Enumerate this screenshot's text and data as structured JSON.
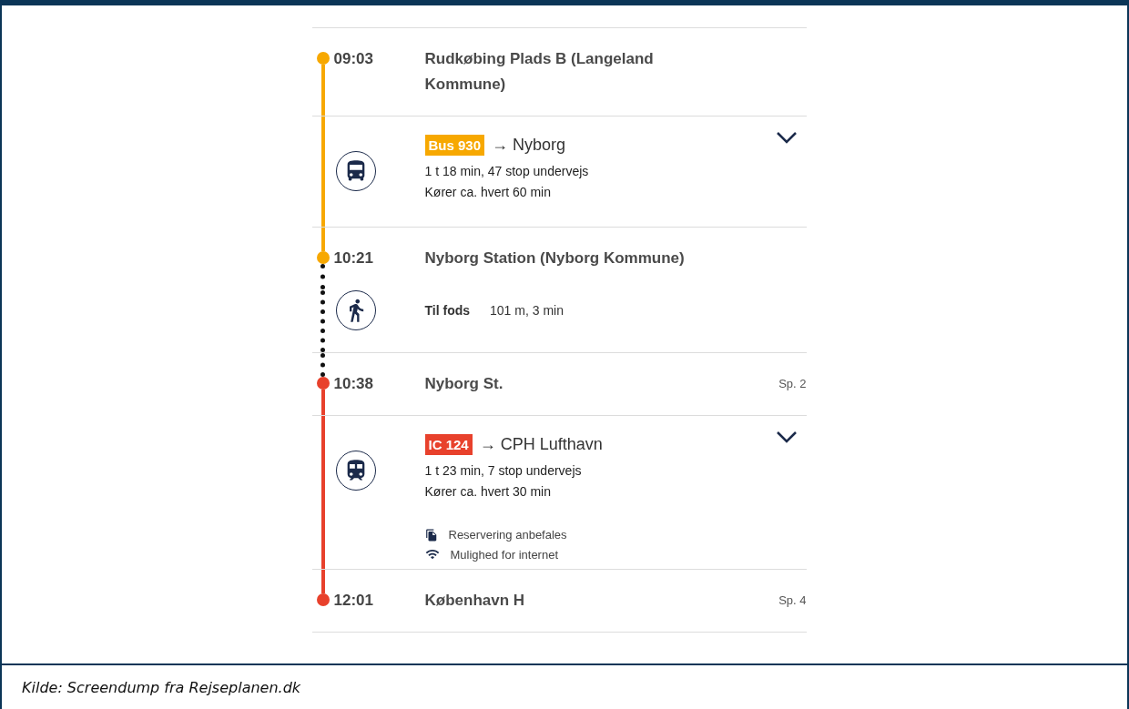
{
  "journey": [
    {
      "kind": "stop",
      "time": "09:03",
      "name": "Rudkøbing Plads B (Langeland Kommune)"
    },
    {
      "kind": "bus",
      "badge": "Bus 930",
      "direction": "→ Nyborg",
      "color": "#f7a800",
      "details": [
        "1 t 18 min, 47 stop undervejs",
        "Kører ca. hvert 60 min"
      ]
    },
    {
      "kind": "stop",
      "time": "10:21",
      "name": "Nyborg Station (Nyborg Kommune)"
    },
    {
      "kind": "walk",
      "label": "Til fods",
      "distance": "101 m, 3 min",
      "color": "#111111"
    },
    {
      "kind": "stop",
      "time": "10:38",
      "name": "Nyborg St.",
      "platform": "Sp. 2"
    },
    {
      "kind": "train",
      "badge": "IC 124",
      "direction": "→ CPH Lufthavn",
      "color": "#e8412c",
      "details": [
        "1 t 23 min, 7 stop undervejs",
        "Kører ca. hvert 30 min"
      ],
      "notes": [
        {
          "kind": "reservation",
          "text": "Reservering anbefales"
        },
        {
          "kind": "wifi",
          "text": "Mulighed for internet"
        }
      ]
    },
    {
      "kind": "stop",
      "time": "12:01",
      "name": "København H",
      "platform": "Sp. 4"
    }
  ],
  "caption": "Kilde: Screendump fra Rejseplanen.dk"
}
